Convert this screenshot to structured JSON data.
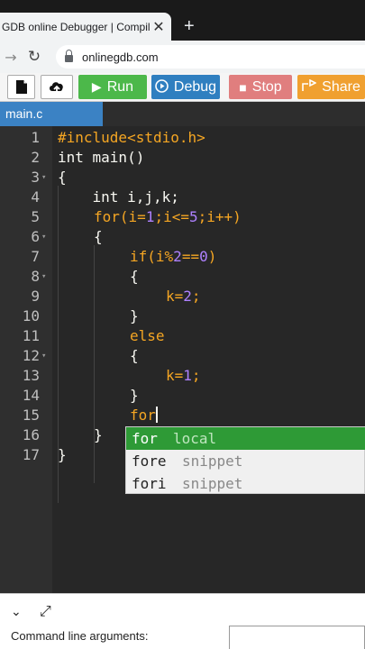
{
  "browser": {
    "tab_title": "GDB online Debugger | Compiler - Code, Compile, Run, Debug online C, C++",
    "close_glyph": "✕",
    "new_tab_glyph": "+",
    "url": "onlinegdb.com"
  },
  "toolbar": {
    "run_label": "Run",
    "debug_label": "Debug",
    "stop_label": "Stop",
    "share_label": "Share"
  },
  "file_tab": "main.c",
  "gutter": [
    "1",
    "2",
    "3",
    "4",
    "5",
    "6",
    "7",
    "8",
    "9",
    "10",
    "11",
    "12",
    "13",
    "14",
    "15",
    "16",
    "17"
  ],
  "code": {
    "l1a": "#include",
    "l1b": "<stdio.h>",
    "l2": "int main()",
    "l3": "{",
    "l4": "    int i,j,k;",
    "l5_for": "for",
    "l5_p1": "(i=",
    "l5_n1": "1",
    "l5_p2": ";i<=",
    "l5_n2": "5",
    "l5_p3": ";i++)",
    "l6": "{",
    "l7_if": "if",
    "l7_p1": "(i%",
    "l7_n1": "2",
    "l7_p2": "==",
    "l7_n2": "0",
    "l7_p3": ")",
    "l8": "{",
    "l9_p1": "k=",
    "l9_n1": "2",
    "l9_p2": ";",
    "l10": "}",
    "l11": "else",
    "l12": "{",
    "l13_p1": "k=",
    "l13_n1": "1",
    "l13_p2": ";",
    "l14": "}",
    "l15": "for",
    "l16": "}",
    "l17": "}"
  },
  "autocomplete": [
    {
      "word": "for",
      "meta": "local"
    },
    {
      "word": "fore",
      "meta": "snippet"
    },
    {
      "word": "fori",
      "meta": "snippet"
    }
  ],
  "bottom": {
    "command_label": "Command line arguments:"
  },
  "colors": {
    "run": "#4cb84a",
    "debug": "#2f7fc0",
    "stop": "#e07e7e",
    "share": "#f0a030",
    "keyword": "#f5a623",
    "number": "#ae81ff",
    "selection": "#2e9a36"
  }
}
